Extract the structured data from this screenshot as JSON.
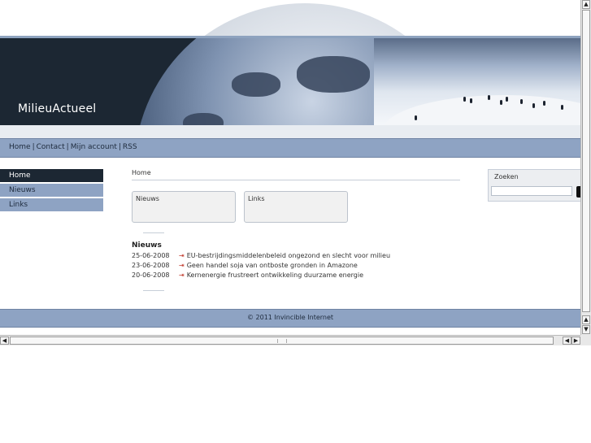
{
  "site": {
    "logo_text": "MilieuActueel"
  },
  "topnav": {
    "items": [
      "Home",
      "Contact",
      "Mijn account",
      "RSS"
    ],
    "separator": "|"
  },
  "left_menu": {
    "items": [
      {
        "label": "Home",
        "active": true
      },
      {
        "label": "Nieuws",
        "active": false
      },
      {
        "label": "Links",
        "active": false
      }
    ]
  },
  "breadcrumb": "Home",
  "boxes": [
    "Nieuws",
    "Links"
  ],
  "news": {
    "title": "Nieuws",
    "items": [
      {
        "date": "25-06-2008",
        "headline": "EU-bestrijdingsmiddelenbeleid ongezond en slecht voor milieu"
      },
      {
        "date": "23-06-2008",
        "headline": "Geen handel soja van ontboste gronden in Amazone"
      },
      {
        "date": "20-06-2008",
        "headline": "Kernenergie frustreert ontwikkeling duurzame energie"
      }
    ]
  },
  "search": {
    "label": "Zoeken",
    "value": ""
  },
  "footer": {
    "text": "© 2011 Invincible Internet"
  },
  "colors": {
    "nav_blue": "#8ea3c3",
    "dark_navy": "#1c2733",
    "link_arrow": "#c0392b"
  },
  "icons": {
    "news_bullet": "arrow-right-icon"
  }
}
